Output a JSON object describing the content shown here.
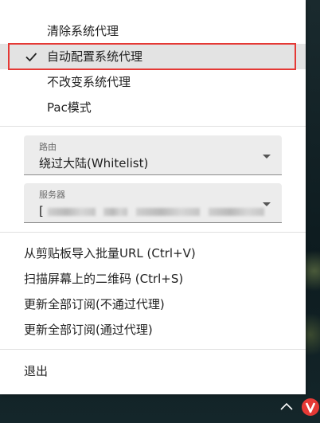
{
  "menu": {
    "proxy_modes": [
      {
        "label": "清除系统代理",
        "checked": false
      },
      {
        "label": "自动配置系统代理",
        "checked": true
      },
      {
        "label": "不改变系统代理",
        "checked": false
      },
      {
        "label": "Pac模式",
        "checked": false
      }
    ],
    "routing": {
      "label": "路由",
      "value": "绕过大陆(Whitelist)"
    },
    "server": {
      "label": "服务器",
      "value_prefix": "["
    },
    "actions": [
      {
        "label": "从剪贴板导入批量URL (Ctrl+V)"
      },
      {
        "label": "扫描屏幕上的二维码 (Ctrl+S)"
      },
      {
        "label": "更新全部订阅(不通过代理)"
      },
      {
        "label": "更新全部订阅(通过代理)"
      }
    ],
    "exit_label": "退出"
  },
  "tray": {
    "app_icon": "v2rayn-icon",
    "chevron_icon": "chevron-up-icon"
  },
  "colors": {
    "highlight_border": "#e53935",
    "selected_bg": "#e3e3e3",
    "tray_icon_bg": "#e53935"
  }
}
